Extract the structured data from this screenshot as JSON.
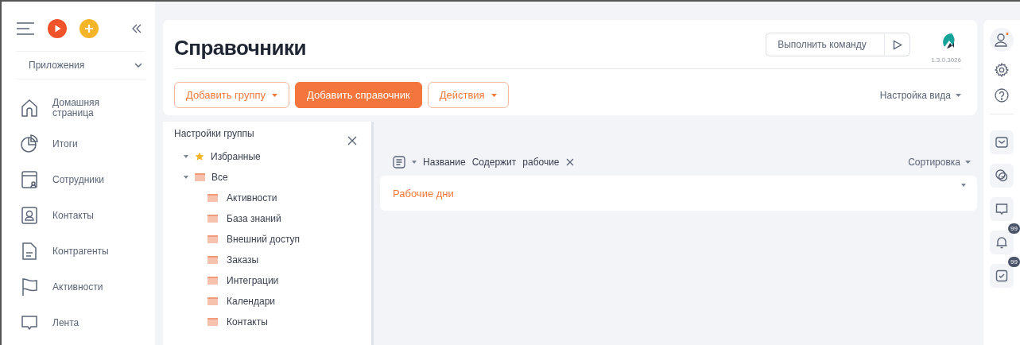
{
  "sidebar": {
    "apps_label": "Приложения",
    "items": [
      {
        "label": "Домашняя страница"
      },
      {
        "label": "Итоги"
      },
      {
        "label": "Сотрудники"
      },
      {
        "label": "Контакты"
      },
      {
        "label": "Контрагенты"
      },
      {
        "label": "Активности"
      },
      {
        "label": "Лента"
      }
    ]
  },
  "header": {
    "title": "Справочники",
    "command": {
      "placeholder": "Выполнить команду"
    },
    "version": "1.3.0.3026"
  },
  "toolbar": {
    "buttons": [
      {
        "label": "Добавить группу",
        "kind": "outline",
        "dropdown": true
      },
      {
        "label": "Добавить справочник",
        "kind": "primary",
        "dropdown": false
      },
      {
        "label": "Действия",
        "kind": "outline",
        "dropdown": true
      }
    ],
    "view_settings": "Настройка вида"
  },
  "group_panel": {
    "title": "Настройки группы",
    "tree": [
      {
        "label": "Избранные",
        "kind": "star",
        "expanded": true
      },
      {
        "label": "Все",
        "kind": "folder",
        "expanded": true,
        "children": [
          {
            "label": "Активности",
            "kind": "folder"
          },
          {
            "label": "База знаний",
            "kind": "folder"
          },
          {
            "label": "Внешний доступ",
            "kind": "folder"
          },
          {
            "label": "Заказы",
            "kind": "folder"
          },
          {
            "label": "Интеграции",
            "kind": "folder"
          },
          {
            "label": "Календари",
            "kind": "folder"
          },
          {
            "label": "Контакты",
            "kind": "folder"
          }
        ]
      }
    ]
  },
  "filter": {
    "field": "Название",
    "operator": "Содержит",
    "value": "рабочие",
    "sort": "Сортировка"
  },
  "results": [
    {
      "label": "Рабочие дни"
    }
  ],
  "right_rail": {
    "buttons": [
      {
        "kind": "mail"
      },
      {
        "kind": "chats"
      },
      {
        "kind": "comment"
      },
      {
        "kind": "bell",
        "badge": "99"
      },
      {
        "kind": "task",
        "badge": "99"
      }
    ]
  }
}
